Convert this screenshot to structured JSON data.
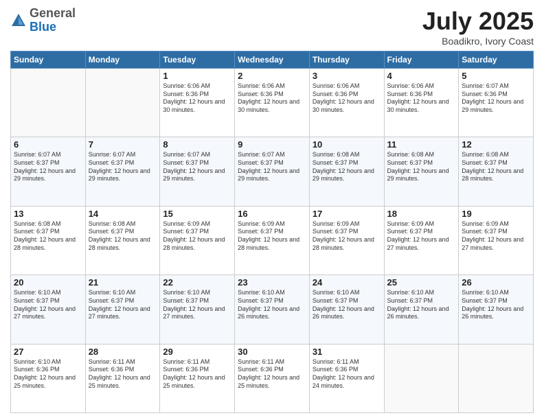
{
  "header": {
    "logo_line1": "General",
    "logo_line2": "Blue",
    "month": "July 2025",
    "location": "Boadikro, Ivory Coast"
  },
  "weekdays": [
    "Sunday",
    "Monday",
    "Tuesday",
    "Wednesday",
    "Thursday",
    "Friday",
    "Saturday"
  ],
  "weeks": [
    [
      {
        "day": "",
        "sunrise": "",
        "sunset": "",
        "daylight": ""
      },
      {
        "day": "",
        "sunrise": "",
        "sunset": "",
        "daylight": ""
      },
      {
        "day": "1",
        "sunrise": "Sunrise: 6:06 AM",
        "sunset": "Sunset: 6:36 PM",
        "daylight": "Daylight: 12 hours and 30 minutes."
      },
      {
        "day": "2",
        "sunrise": "Sunrise: 6:06 AM",
        "sunset": "Sunset: 6:36 PM",
        "daylight": "Daylight: 12 hours and 30 minutes."
      },
      {
        "day": "3",
        "sunrise": "Sunrise: 6:06 AM",
        "sunset": "Sunset: 6:36 PM",
        "daylight": "Daylight: 12 hours and 30 minutes."
      },
      {
        "day": "4",
        "sunrise": "Sunrise: 6:06 AM",
        "sunset": "Sunset: 6:36 PM",
        "daylight": "Daylight: 12 hours and 30 minutes."
      },
      {
        "day": "5",
        "sunrise": "Sunrise: 6:07 AM",
        "sunset": "Sunset: 6:36 PM",
        "daylight": "Daylight: 12 hours and 29 minutes."
      }
    ],
    [
      {
        "day": "6",
        "sunrise": "Sunrise: 6:07 AM",
        "sunset": "Sunset: 6:37 PM",
        "daylight": "Daylight: 12 hours and 29 minutes."
      },
      {
        "day": "7",
        "sunrise": "Sunrise: 6:07 AM",
        "sunset": "Sunset: 6:37 PM",
        "daylight": "Daylight: 12 hours and 29 minutes."
      },
      {
        "day": "8",
        "sunrise": "Sunrise: 6:07 AM",
        "sunset": "Sunset: 6:37 PM",
        "daylight": "Daylight: 12 hours and 29 minutes."
      },
      {
        "day": "9",
        "sunrise": "Sunrise: 6:07 AM",
        "sunset": "Sunset: 6:37 PM",
        "daylight": "Daylight: 12 hours and 29 minutes."
      },
      {
        "day": "10",
        "sunrise": "Sunrise: 6:08 AM",
        "sunset": "Sunset: 6:37 PM",
        "daylight": "Daylight: 12 hours and 29 minutes."
      },
      {
        "day": "11",
        "sunrise": "Sunrise: 6:08 AM",
        "sunset": "Sunset: 6:37 PM",
        "daylight": "Daylight: 12 hours and 29 minutes."
      },
      {
        "day": "12",
        "sunrise": "Sunrise: 6:08 AM",
        "sunset": "Sunset: 6:37 PM",
        "daylight": "Daylight: 12 hours and 28 minutes."
      }
    ],
    [
      {
        "day": "13",
        "sunrise": "Sunrise: 6:08 AM",
        "sunset": "Sunset: 6:37 PM",
        "daylight": "Daylight: 12 hours and 28 minutes."
      },
      {
        "day": "14",
        "sunrise": "Sunrise: 6:08 AM",
        "sunset": "Sunset: 6:37 PM",
        "daylight": "Daylight: 12 hours and 28 minutes."
      },
      {
        "day": "15",
        "sunrise": "Sunrise: 6:09 AM",
        "sunset": "Sunset: 6:37 PM",
        "daylight": "Daylight: 12 hours and 28 minutes."
      },
      {
        "day": "16",
        "sunrise": "Sunrise: 6:09 AM",
        "sunset": "Sunset: 6:37 PM",
        "daylight": "Daylight: 12 hours and 28 minutes."
      },
      {
        "day": "17",
        "sunrise": "Sunrise: 6:09 AM",
        "sunset": "Sunset: 6:37 PM",
        "daylight": "Daylight: 12 hours and 28 minutes."
      },
      {
        "day": "18",
        "sunrise": "Sunrise: 6:09 AM",
        "sunset": "Sunset: 6:37 PM",
        "daylight": "Daylight: 12 hours and 27 minutes."
      },
      {
        "day": "19",
        "sunrise": "Sunrise: 6:09 AM",
        "sunset": "Sunset: 6:37 PM",
        "daylight": "Daylight: 12 hours and 27 minutes."
      }
    ],
    [
      {
        "day": "20",
        "sunrise": "Sunrise: 6:10 AM",
        "sunset": "Sunset: 6:37 PM",
        "daylight": "Daylight: 12 hours and 27 minutes."
      },
      {
        "day": "21",
        "sunrise": "Sunrise: 6:10 AM",
        "sunset": "Sunset: 6:37 PM",
        "daylight": "Daylight: 12 hours and 27 minutes."
      },
      {
        "day": "22",
        "sunrise": "Sunrise: 6:10 AM",
        "sunset": "Sunset: 6:37 PM",
        "daylight": "Daylight: 12 hours and 27 minutes."
      },
      {
        "day": "23",
        "sunrise": "Sunrise: 6:10 AM",
        "sunset": "Sunset: 6:37 PM",
        "daylight": "Daylight: 12 hours and 26 minutes."
      },
      {
        "day": "24",
        "sunrise": "Sunrise: 6:10 AM",
        "sunset": "Sunset: 6:37 PM",
        "daylight": "Daylight: 12 hours and 26 minutes."
      },
      {
        "day": "25",
        "sunrise": "Sunrise: 6:10 AM",
        "sunset": "Sunset: 6:37 PM",
        "daylight": "Daylight: 12 hours and 26 minutes."
      },
      {
        "day": "26",
        "sunrise": "Sunrise: 6:10 AM",
        "sunset": "Sunset: 6:37 PM",
        "daylight": "Daylight: 12 hours and 26 minutes."
      }
    ],
    [
      {
        "day": "27",
        "sunrise": "Sunrise: 6:10 AM",
        "sunset": "Sunset: 6:36 PM",
        "daylight": "Daylight: 12 hours and 25 minutes."
      },
      {
        "day": "28",
        "sunrise": "Sunrise: 6:11 AM",
        "sunset": "Sunset: 6:36 PM",
        "daylight": "Daylight: 12 hours and 25 minutes."
      },
      {
        "day": "29",
        "sunrise": "Sunrise: 6:11 AM",
        "sunset": "Sunset: 6:36 PM",
        "daylight": "Daylight: 12 hours and 25 minutes."
      },
      {
        "day": "30",
        "sunrise": "Sunrise: 6:11 AM",
        "sunset": "Sunset: 6:36 PM",
        "daylight": "Daylight: 12 hours and 25 minutes."
      },
      {
        "day": "31",
        "sunrise": "Sunrise: 6:11 AM",
        "sunset": "Sunset: 6:36 PM",
        "daylight": "Daylight: 12 hours and 24 minutes."
      },
      {
        "day": "",
        "sunrise": "",
        "sunset": "",
        "daylight": ""
      },
      {
        "day": "",
        "sunrise": "",
        "sunset": "",
        "daylight": ""
      }
    ]
  ]
}
